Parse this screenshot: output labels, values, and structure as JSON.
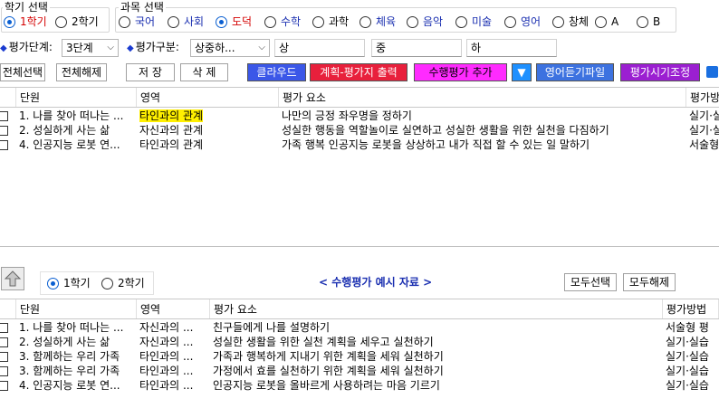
{
  "semester_select": {
    "title": "학기 선택",
    "options": [
      "1학기",
      "2학기"
    ],
    "selected": "1학기"
  },
  "subject_select": {
    "title": "과목 선택",
    "options": [
      "국어",
      "사회",
      "도덕",
      "수학",
      "과학",
      "체육",
      "음악",
      "미술",
      "영어",
      "창체",
      "A",
      "B"
    ],
    "selected": "도덕"
  },
  "filter": {
    "level_label": "평가단계:",
    "level_value": "3단계",
    "type_label": "평가구분:",
    "type_value": "상중하...",
    "high": "상",
    "mid": "중",
    "low": "하"
  },
  "toolbar": {
    "select_all": "전체선택",
    "deselect_all": "전체해제",
    "save": "저 장",
    "delete": "삭 제",
    "cloud": "클라우드",
    "plan_print": "계획-평가지 출력",
    "add_assessment": "수행평가 추가",
    "dropdown_arrow": "▼",
    "english_listening": "영어듣기파일",
    "schedule_adjust": "평가시기조정",
    "colors": {
      "cloud": "#3b57e8",
      "plan_print": "#e8203c",
      "add_assessment": "#ff2bff",
      "dropdown": "#1e90ff",
      "english_listening": "#3d72e0",
      "schedule_adjust": "#9b1fd1"
    }
  },
  "top_grid": {
    "headers": [
      "단원",
      "영역",
      "평가 요소",
      "평가방"
    ],
    "rows": [
      {
        "unit": "1. 나를 찾아 떠나는 ...",
        "area": "타인과의 관계",
        "element": "나만의 긍정 좌우명을 정하기",
        "method": "실기·실",
        "highlight": true
      },
      {
        "unit": "2. 성실하게 사는 삶",
        "area": "자신과의 관계",
        "element": "성실한 행동을 역할놀이로 실연하고 성실한 생활을 위한 실천을 다짐하기",
        "method": "실기·실",
        "highlight": false
      },
      {
        "unit": "4. 인공지능 로봇 연...",
        "area": "타인과의 관계",
        "element": "가족 행복 인공지능 로봇을 상상하고 내가 직접 할 수 있는 일 말하기",
        "method": "서술형",
        "highlight": false
      }
    ]
  },
  "bottom_panel": {
    "up_icon": "up-arrow-icon",
    "semester_options": [
      "1학기",
      "2학기"
    ],
    "semester_selected": "1학기",
    "title": "< 수행평가 예시 자료 >",
    "select_all": "모두선택",
    "deselect_all": "모두해제"
  },
  "bottom_grid": {
    "headers": [
      "단원",
      "영역",
      "평가 요소",
      "평가방법"
    ],
    "rows": [
      {
        "unit": "1. 나를 찾아 떠나는 ...",
        "area": "자신과의 ...",
        "element": "친구들에게 나를 설명하기",
        "method": "서술형 평"
      },
      {
        "unit": "2. 성실하게 사는 삶",
        "area": "자신과의 ...",
        "element": "성실한 생활을 위한 실천 계획을 세우고 실천하기",
        "method": "실기·실습"
      },
      {
        "unit": "3. 함께하는 우리 가족",
        "area": "타인과의 ...",
        "element": "가족과 행복하게 지내기 위한 계획을 세워 실천하기",
        "method": "실기·실습"
      },
      {
        "unit": "3. 함께하는 우리 가족",
        "area": "타인과의 ...",
        "element": "가정에서 효를 실천하기 위한 계획을 세워 실천하기",
        "method": "실기·실습"
      },
      {
        "unit": "4. 인공지능 로봇 연...",
        "area": "타인과의 ...",
        "element": "인공지능 로봇을 올바르게 사용하려는 마음 기르기",
        "method": "실기·실습"
      }
    ]
  }
}
